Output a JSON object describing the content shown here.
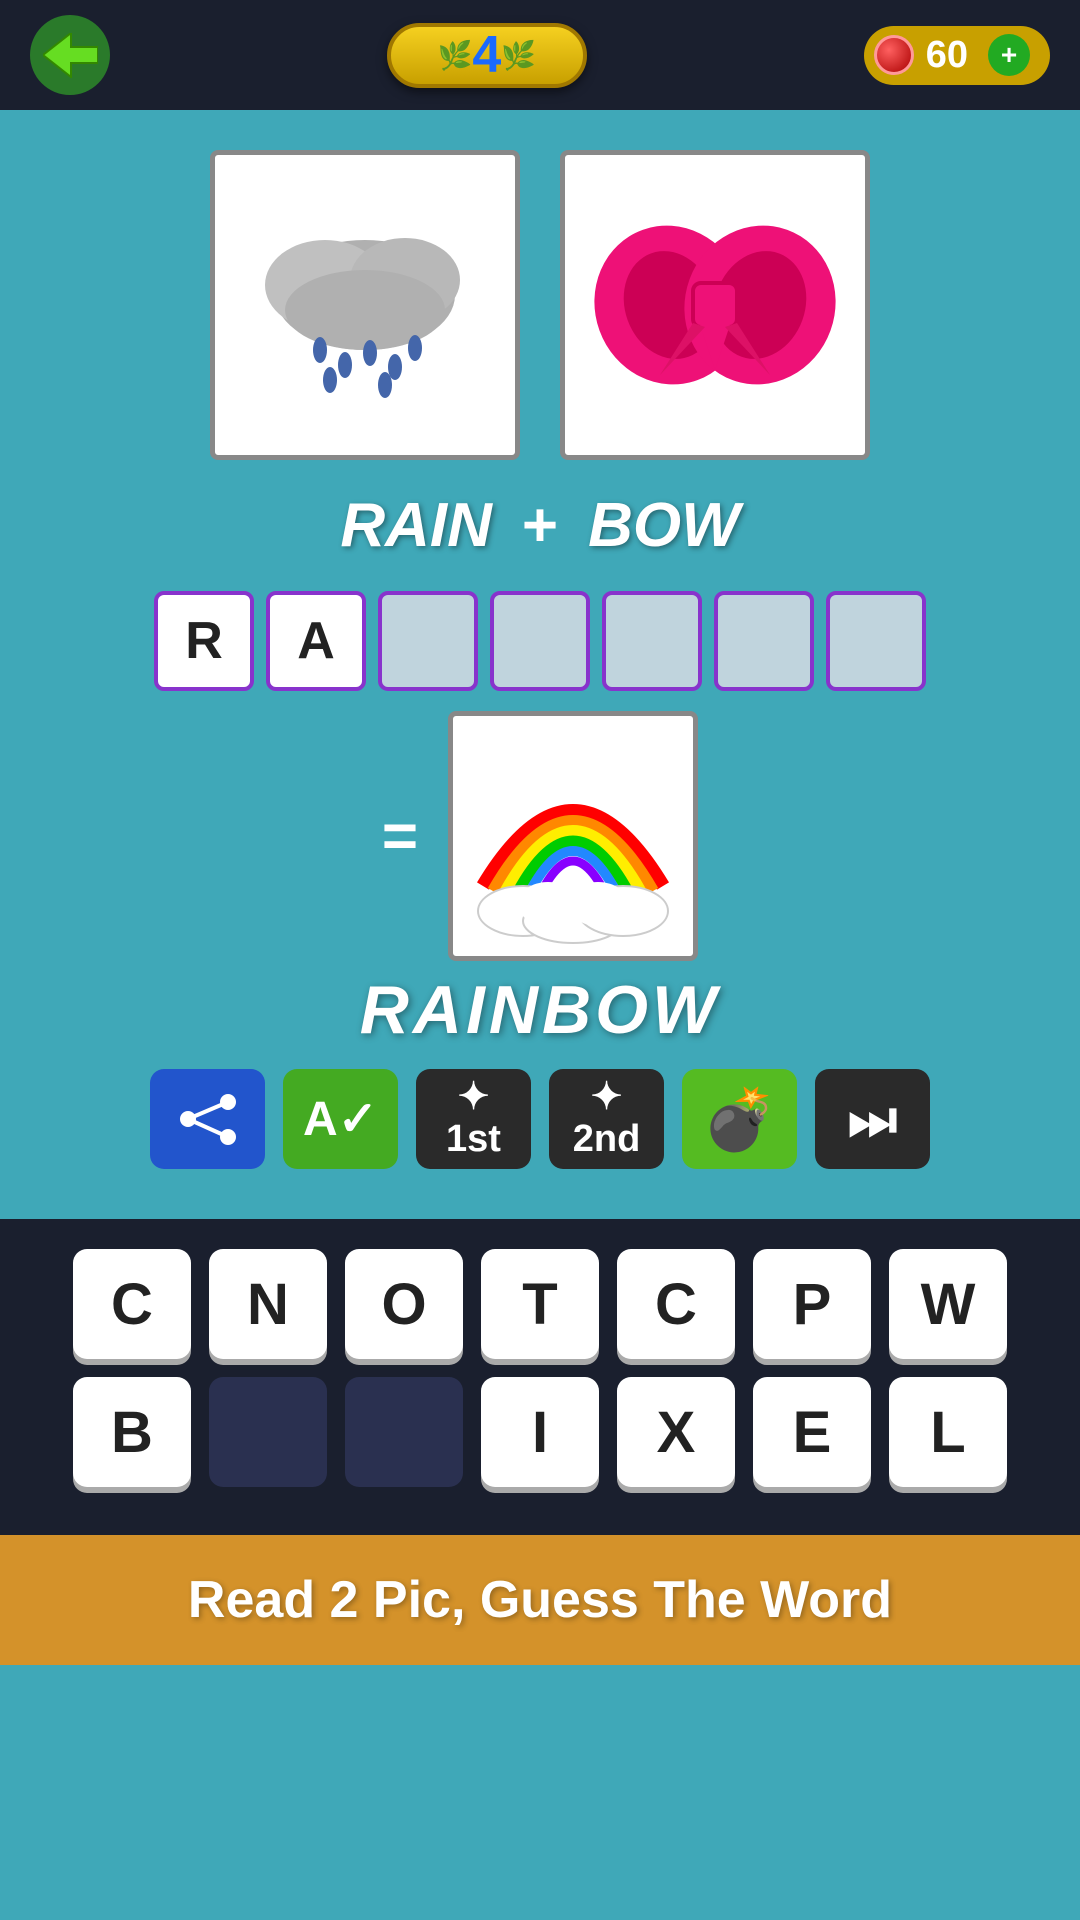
{
  "header": {
    "back_label": "←",
    "level": "4",
    "coins": "60"
  },
  "game": {
    "word1": "RAIN",
    "word2": "BOW",
    "plus_sign": "+",
    "equals_sign": "=",
    "answer_letters": [
      "R",
      "A",
      "",
      "",
      "",
      "",
      ""
    ],
    "result_word": "RAINBOW"
  },
  "action_buttons": [
    {
      "id": "share",
      "label": "share"
    },
    {
      "id": "hint_letter",
      "label": "A✓"
    },
    {
      "id": "first_hint",
      "label": "1st"
    },
    {
      "id": "second_hint",
      "label": "2nd"
    },
    {
      "id": "bomb",
      "label": "💣"
    },
    {
      "id": "skip",
      "label": "⏭"
    }
  ],
  "keyboard": {
    "row1": [
      "C",
      "N",
      "O",
      "T",
      "C",
      "P",
      "W"
    ],
    "row2": [
      "B",
      "",
      "",
      "I",
      "X",
      "E",
      "L"
    ]
  },
  "banner": {
    "text": "Read 2 Pic, Guess The Word"
  }
}
